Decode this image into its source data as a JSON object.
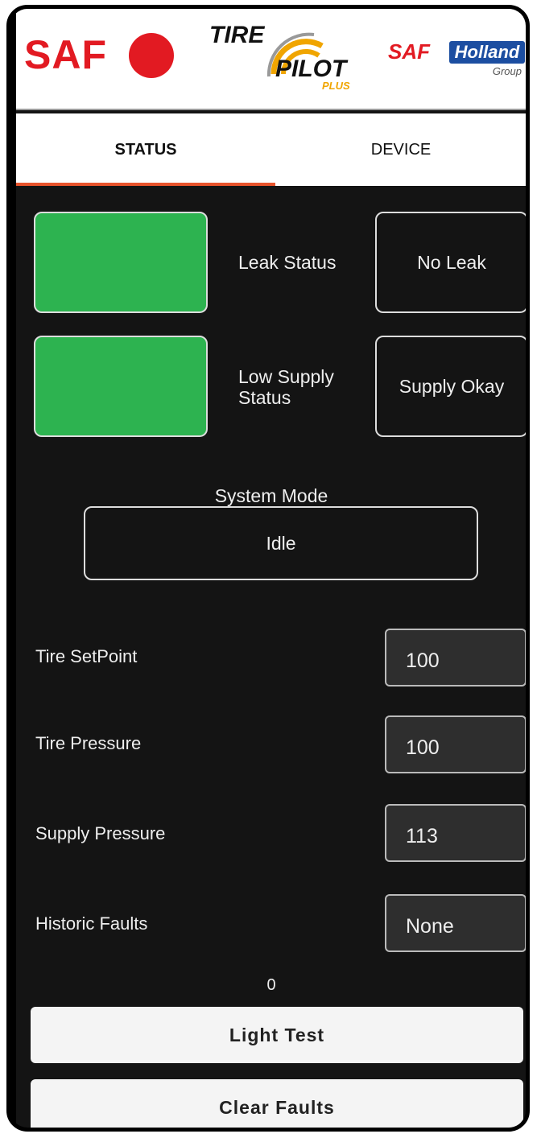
{
  "header": {
    "saf_logo": "SAF",
    "tirepilot_logo": {
      "line1": "TIRE",
      "line2": "PILOT",
      "line3": "PLUS"
    },
    "safholland_logo": {
      "part1": "SAF",
      "part2": "Holland",
      "part3": "Group"
    }
  },
  "tabs": [
    {
      "label": "STATUS",
      "active": true
    },
    {
      "label": "DEVICE",
      "active": false
    }
  ],
  "status": {
    "leak": {
      "label": "Leak Status",
      "value": "No Leak",
      "indicator_color": "#2db350"
    },
    "supply": {
      "label_line1": "Low Supply",
      "label_line2": "Status",
      "value": "Supply Okay",
      "indicator_color": "#2db350"
    },
    "system_mode": {
      "label": "System Mode",
      "value": "Idle"
    }
  },
  "readings": [
    {
      "label": "Tire SetPoint",
      "value": "100"
    },
    {
      "label": "Tire Pressure",
      "value": "100"
    },
    {
      "label": "Supply Pressure",
      "value": "113"
    },
    {
      "label": "Historic Faults",
      "value": "None"
    }
  ],
  "counter": "0",
  "buttons": {
    "light_test": "Light Test",
    "clear_faults": "Clear Faults"
  },
  "colors": {
    "accent": "#e8542c",
    "ok_green": "#2db350",
    "background": "#141414",
    "brand_red": "#e21a22"
  }
}
